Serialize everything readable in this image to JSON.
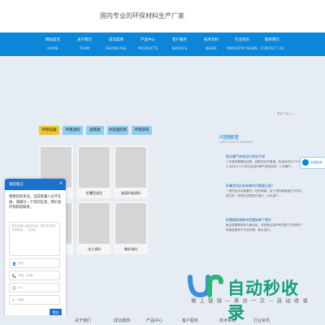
{
  "header": {
    "tagline": "国内专业的环保材料生产厂家"
  },
  "nav": {
    "items": [
      {
        "cn": "网站首页",
        "en": "HOME"
      },
      {
        "cn": "关于我们",
        "en": "TEAM"
      },
      {
        "cn": "成功案例",
        "en": "SHOWCASE"
      },
      {
        "cn": "产品中心",
        "en": "PRODUCTS"
      },
      {
        "cn": "客户服务",
        "en": "SERVICE"
      },
      {
        "cn": "技术资料",
        "en": "NEWS"
      },
      {
        "cn": "行业资讯",
        "en": "INDUSTRY NEWS"
      },
      {
        "cn": "联系我们",
        "en": "CONTACT US"
      }
    ]
  },
  "products": {
    "tabs": [
      "环保设备",
      "环保滤料",
      "滤筒类",
      "水处理药剂",
      "环保滤布"
    ],
    "cards": [
      {
        "caption": ""
      },
      {
        "caption": "折叠型滤芯"
      },
      {
        "caption": "玻璃纤维滤料"
      },
      {
        "caption": ""
      },
      {
        "caption": "化工滤料"
      },
      {
        "caption": "聚砂滤料"
      }
    ]
  },
  "news": {
    "more_label": "更多产品>>",
    "title": "问题解答",
    "subtitle": "QUESTIONS & ANSWERS",
    "items": [
      {
        "title": "管式曝气系统运行指导手册",
        "desc": "1.安装前要确定池底，装配适合的管道；在适水池引3个以上大约20个工作日后进行曝气系统检修。2.对曝气…"
      },
      {
        "title": "折叠型的反洗有哪些问题要注意？",
        "desc": "一般的反冲洗装置在一定的周期，由于滤料被截留在中的杂质过多；导致过滤层阻力增大，出水量下…"
      },
      {
        "title": "铝酸镁除铁聚合铝酸钠哪个更好",
        "desc": "聚合铝酸镁除铁与聚合铝，双铁聚合铝对有机物三价铁离子和重金属离子去除效果，聚合铝对…"
      }
    ]
  },
  "side_badge": {
    "label": "在线咨询"
  },
  "chat": {
    "title": "请您留言",
    "close": "×",
    "message": "感谢您的关注，当前客服人员不在线，请填写一下您的信息，我们会尽快和您联系。",
    "textarea_placeholder": "请在此输入留言内容，我们会尽快与您联系。（必填）",
    "fields": [
      {
        "icon": "👤",
        "placeholder": "姓名"
      },
      {
        "icon": "📞",
        "placeholder": "电话（必填）"
      },
      {
        "icon": "💬",
        "placeholder": "QQ"
      },
      {
        "icon": "✉",
        "placeholder": "邮箱"
      }
    ],
    "send": "提交"
  },
  "watermark": {
    "brand": "自动秒收录",
    "slogan": "做 上 链 接 — 来 访 一 次 — 自 动 收 录"
  },
  "footer": {
    "items": [
      "关于我们",
      "成功案例",
      "产品中心",
      "客户服务",
      "技术资料",
      "行业资讯"
    ]
  }
}
